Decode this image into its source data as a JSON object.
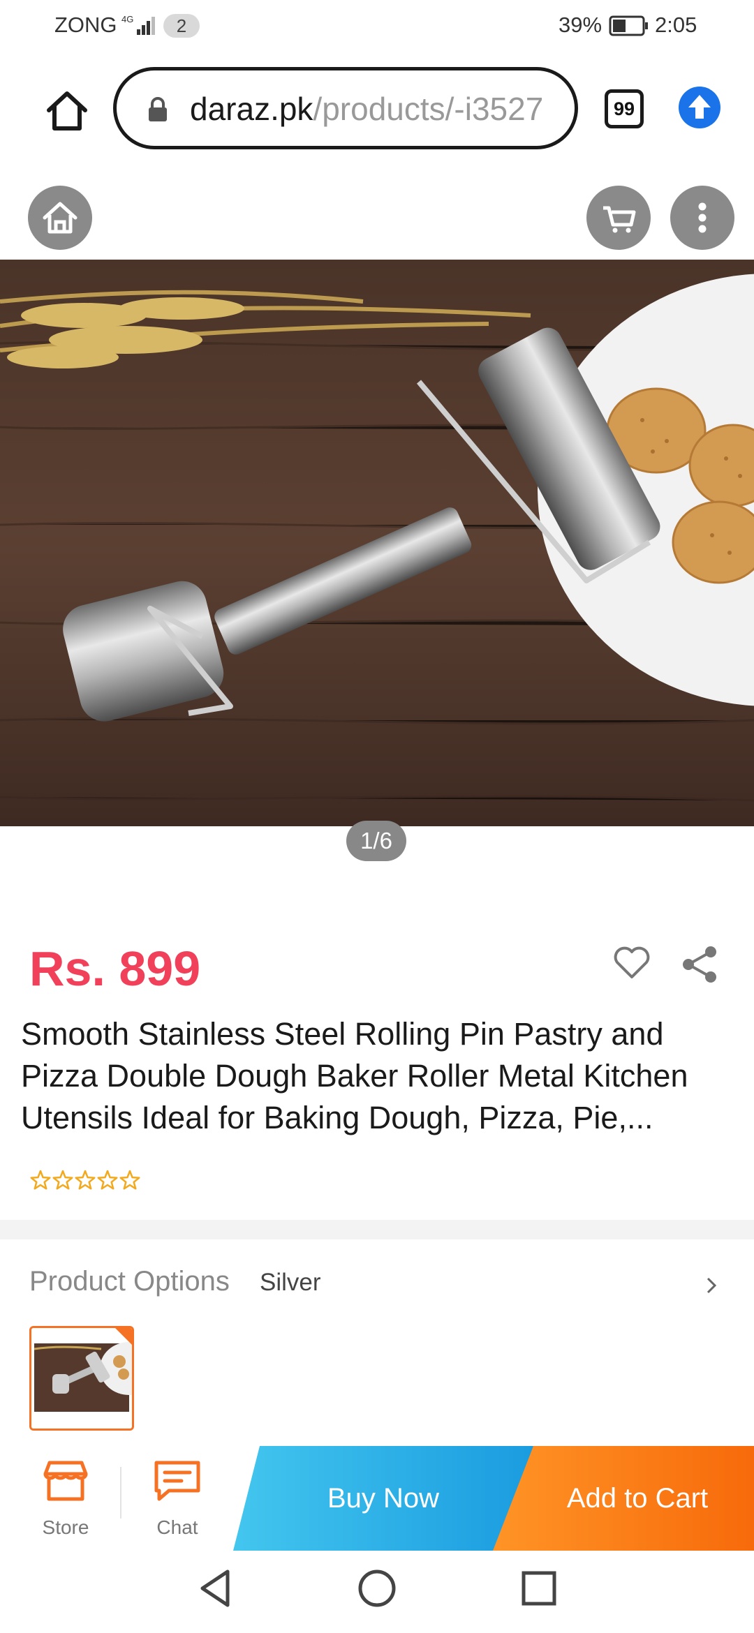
{
  "status_bar": {
    "carrier": "ZONG",
    "network": "4G",
    "sim_count": "2",
    "battery": "39%",
    "time": "2:05"
  },
  "browser": {
    "url_domain": "daraz.pk",
    "url_path": "/products/-i3527",
    "tab_count": "99",
    "icons": [
      "home-icon",
      "lock-icon",
      "tabs-icon",
      "upload-arrow-icon"
    ]
  },
  "overlay_icons": [
    "home-icon",
    "cart-icon",
    "more-vert-icon"
  ],
  "gallery": {
    "counter": "1/6"
  },
  "product": {
    "price": "Rs. 899",
    "title": "Smooth Stainless Steel Rolling Pin Pastry and Pizza Double Dough Baker Roller Metal Kitchen Utensils Ideal for Baking Dough, Pizza, Pie,...",
    "rating_stars": 0,
    "rating_max": 5
  },
  "options": {
    "label": "Product Options",
    "value": "Silver"
  },
  "action_bar": {
    "store_label": "Store",
    "chat_label": "Chat",
    "buy_now_label": "Buy Now",
    "add_to_cart_label": "Add to Cart"
  },
  "colors": {
    "price": "#f0405a",
    "buy_now": "#1a9ce0",
    "add_to_cart": "#f76a0b",
    "accent_orange": "#f57224"
  }
}
